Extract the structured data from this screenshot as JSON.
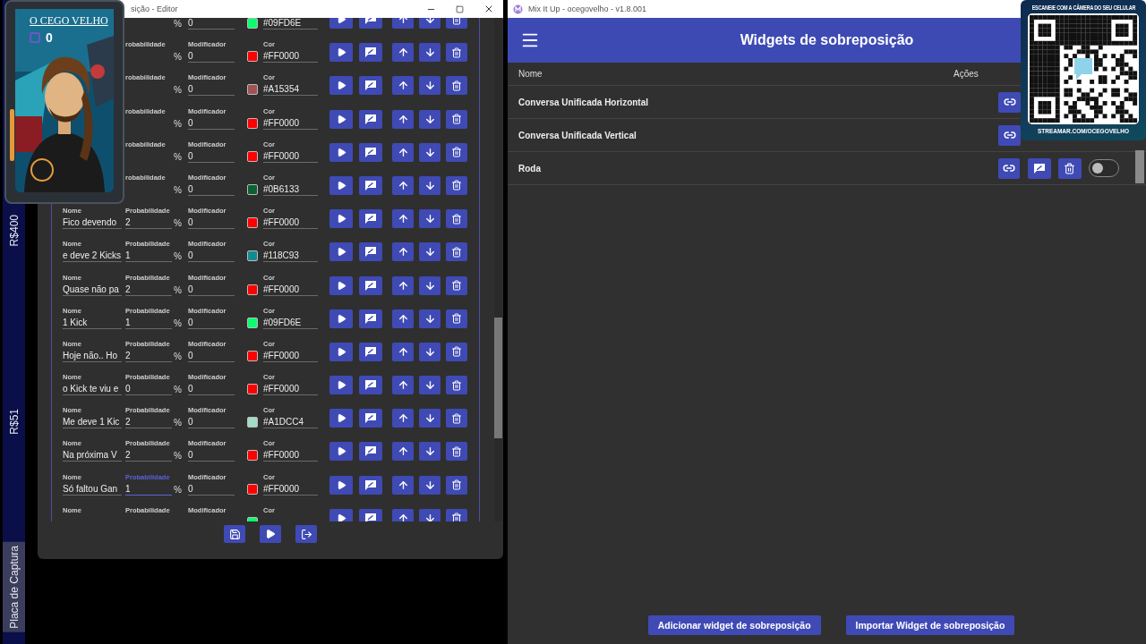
{
  "desktop_strip": {
    "items": [
      {
        "text": "R$400",
        "highlighted": false
      },
      {
        "text": "R$51",
        "highlighted": false
      },
      {
        "text": "Placa de Captura",
        "highlighted": true
      }
    ]
  },
  "stream_overlay": {
    "title": "O CEGO VELHO",
    "count": "0"
  },
  "editor": {
    "title": "sição - Editor",
    "rows": [
      {
        "mod": "0",
        "unit": "%",
        "hex": "#09FD6E",
        "color": "#09fd6e"
      },
      {
        "prob_label": "robabilidade",
        "unit": "%",
        "mod_label": "Modificador",
        "mod": "0",
        "color_label": "Cor",
        "hex": "#FF0000",
        "color": "#ff0000"
      },
      {
        "prob_label": "robabilidade",
        "unit": "%",
        "mod_label": "Modificador",
        "mod": "0",
        "color_label": "Cor",
        "hex": "#A15354",
        "color": "#a15354"
      },
      {
        "prob_label": "robabilidade",
        "unit": "%",
        "mod_label": "Modificador",
        "mod": "0",
        "color_label": "Cor",
        "hex": "#FF0000",
        "color": "#ff0000"
      },
      {
        "prob_label": "robabilidade",
        "unit": "%",
        "mod_label": "Modificador",
        "mod": "0",
        "color_label": "Cor",
        "hex": "#FF0000",
        "color": "#ff0000"
      },
      {
        "prob_label": "robabilidade",
        "unit": "%",
        "mod_label": "Modificador",
        "mod": "0",
        "color_label": "Cor",
        "hex": "#0B6133",
        "color": "#0b6133"
      },
      {
        "name_label": "Nome",
        "name": "Fico devendo",
        "prob_label": "Probabilidade",
        "prob": "2",
        "unit": "%",
        "mod_label": "Modificador",
        "mod": "0",
        "color_label": "Cor",
        "hex": "#FF0000",
        "color": "#ff0000"
      },
      {
        "name_label": "Nome",
        "name": "e deve 2 Kicks",
        "prob_label": "Probabilidade",
        "prob": "1",
        "unit": "%",
        "mod_label": "Modificador",
        "mod": "0",
        "color_label": "Cor",
        "hex": "#118C93",
        "color": "#118c93"
      },
      {
        "name_label": "Nome",
        "name": "Quase não pa",
        "prob_label": "Probabilidade",
        "prob": "2",
        "unit": "%",
        "mod_label": "Modificador",
        "mod": "0",
        "color_label": "Cor",
        "hex": "#FF0000",
        "color": "#ff0000"
      },
      {
        "name_label": "Nome",
        "name": "1 Kick",
        "prob_label": "Probabilidade",
        "prob": "1",
        "unit": "%",
        "mod_label": "Modificador",
        "mod": "0",
        "color_label": "Cor",
        "hex": "#09FD6E",
        "color": "#09fd6e"
      },
      {
        "name_label": "Nome",
        "name": "Hoje não.. Ho",
        "prob_label": "Probabilidade",
        "prob": "2",
        "unit": "%",
        "mod_label": "Modificador",
        "mod": "0",
        "color_label": "Cor",
        "hex": "#FF0000",
        "color": "#ff0000"
      },
      {
        "name_label": "Nome",
        "name": "o Kick te viu e",
        "prob_label": "Probabilidade",
        "prob": "0",
        "unit": "%",
        "mod_label": "Modificador",
        "mod": "0",
        "color_label": "Cor",
        "hex": "#FF0000",
        "color": "#ff0000"
      },
      {
        "name_label": "Nome",
        "name": "Me deve 1 Kic",
        "prob_label": "Probabilidade",
        "prob": "2",
        "unit": "%",
        "mod_label": "Modificador",
        "mod": "0",
        "color_label": "Cor",
        "hex": "#A1DCC4",
        "color": "#a1dcc4"
      },
      {
        "name_label": "Nome",
        "name": "Na próxima V",
        "prob_label": "Probabilidade",
        "prob": "2",
        "unit": "%",
        "mod_label": "Modificador",
        "mod": "0",
        "color_label": "Cor",
        "hex": "#FF0000",
        "color": "#ff0000"
      },
      {
        "name_label": "Nome",
        "name": "Só faltou Gan",
        "prob_label": "Probabilidade",
        "prob": "1",
        "unit": "%",
        "mod_label": "Modificador",
        "mod": "0",
        "color_label": "Cor",
        "hex": "#FF0000",
        "color": "#ff0000",
        "focused": true
      },
      {
        "name_label": "Nome",
        "prob_label": "Probabilidade",
        "mod_label": "Modificador",
        "color_label": "Cor",
        "color": "#09fd6e"
      }
    ]
  },
  "qr_card": {
    "heading": "ESCANEIE COM A CÂMERA DO SEU CELULAR",
    "url": "STREAMAR.COM/OCEGOVELHO"
  },
  "app": {
    "title": "Mix It Up - ocegovelho - v1.8.001",
    "header": "Widgets de sobreposição",
    "columns": [
      "Nome",
      "Ações"
    ],
    "widgets": [
      {
        "name": "Conversa Unificada Horizontal"
      },
      {
        "name": "Conversa Unificada Vertical"
      },
      {
        "name": "Roda",
        "on": false
      }
    ],
    "buttons": [
      "Adicionar widget de sobreposição",
      "Importar Widget de sobreposição"
    ]
  }
}
